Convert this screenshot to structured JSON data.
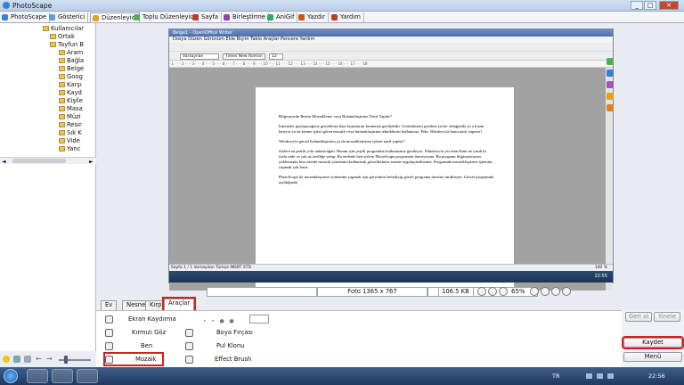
{
  "app": {
    "title": "PhotoScape"
  },
  "window_controls": [
    "_",
    "□",
    "✕"
  ],
  "main_tabs": [
    {
      "label": "PhotoScape",
      "color": "#3b7dd8"
    },
    {
      "label": "Gösterici",
      "color": "#5aa0d6"
    },
    {
      "label": "Düzenleyici",
      "color": "#e0a020"
    },
    {
      "label": "Toplu Düzenleyici",
      "color": "#4caf50"
    },
    {
      "label": "Sayfa",
      "color": "#c0392b"
    },
    {
      "label": "Birleştirme",
      "color": "#8e44ad"
    },
    {
      "label": "AniGif",
      "color": "#27ae60"
    },
    {
      "label": "Yazdır",
      "color": "#d35400"
    },
    {
      "label": "Yardım",
      "color": "#c0392b"
    }
  ],
  "tree": {
    "nodes": [
      {
        "label": "Kullanıcılar"
      },
      {
        "label": "Ortak"
      },
      {
        "label": "Tayfun B"
      },
      {
        "label": "Aram"
      },
      {
        "label": "Bağla"
      },
      {
        "label": "Belge"
      },
      {
        "label": "Goog"
      },
      {
        "label": "Karşı"
      },
      {
        "label": "Kayd"
      },
      {
        "label": "Kişile"
      },
      {
        "label": "Masa"
      },
      {
        "label": "Müzi"
      },
      {
        "label": "Resir"
      },
      {
        "label": "Sık K"
      },
      {
        "label": "Vide"
      },
      {
        "label": "Yanc"
      }
    ]
  },
  "writer": {
    "window_title": "Belge1 - OpenOffice Writer",
    "menu": "Dosya  Düzen  Görünüm  Ekle  Biçim  Tablo  Araçlar  Pencere  Yardım",
    "style_combo": "Varsayılan",
    "font_combo": "Times New Roman",
    "size_combo": "12",
    "ruler": "· 1 · · · 2 · · · 3 · · · 4 · · · 5 · · · 6 · · · 7 · · · 8 · · · 9 · · · 10 · · · 11 · · · 12 · · · 13 · · · 14 · · · 15 · · · 16 · · · 17 · · · 18",
    "paragraphs": [
      "Bilgisayarda Resim Mozaikleme veya Bulanıklaştırma Nasıl Yapılır?",
      "İnternette paylaşacağınız görsellerin bazı kısımlarını kesmeniz gerekebilir. Görüntümesi gereken yerler olduğunda ya o kısmı kesiyor ya da kesme işlevi gören mozaik veya bulanıklaştırma tekniklerini kullanırsız. Peki, Windows'ta bunu nasıl yaparız?",
      "Windows'ta görsel bulanıklaştırma ya da mozaikleştirme işlemi nasıl yapılır?",
      "Sizlere en pratik yolu anlatacağım. Bunun için çeşitli programlar kullanmanız gerekiyor. Windows'ta yer alan Paint ne yazık ki fazla sade ve çok az özelliğe sahip. Bu nedenle ben sizlere PhotoScape programını öneriyorum. Bu program bilgisayarınıza yüklemenin kısa sürede mozaik yönetmini kullanarak görsellerinize sansür uygulayabilirsiniz. Programda mozaikleştirme işlemini yapmak çok basit.",
      "PhotoScape ile mozaikleştirme yöntemini yapmak için görselinizi belediyip görsel programa üzerine sürükleyin. Görsel programda açıldığında|"
    ],
    "status": "Sayfa 1 / 1          Varsayılan                                Türkçe          INSRT   STD   ·",
    "zoom": "100 %",
    "clock": "22:55"
  },
  "info": {
    "dimensions": "Foto 1365 x 767",
    "filesize": "106.5 KB",
    "zoom": "65%"
  },
  "edit_tabs": [
    {
      "label": "Ev"
    },
    {
      "label": "Nesne"
    },
    {
      "label": "Kırp"
    },
    {
      "label": "Araçlar",
      "active": true
    }
  ],
  "tools": {
    "col1": [
      {
        "label": "Ekran Kaydırma"
      },
      {
        "label": "Kırmızı Göz"
      },
      {
        "label": "Ben"
      },
      {
        "label": "Mozaik",
        "highlighted": true
      }
    ],
    "col2": [
      {
        "label": "Boya Fırçası"
      },
      {
        "label": "Pul Klonu"
      },
      {
        "label": "Effect Brush"
      }
    ]
  },
  "right_buttons": {
    "undo": "Geri al",
    "redo": "Yinele",
    "save": "Kaydet",
    "menu": "Menü"
  },
  "taskbar": {
    "lang": "TR",
    "clock": "22:56"
  },
  "accent": {
    "highlight": "#d42020",
    "taskbar": "#2a4a78"
  }
}
